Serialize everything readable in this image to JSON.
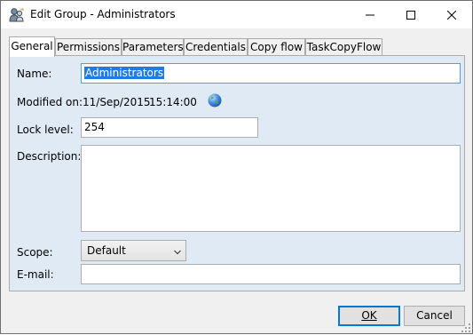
{
  "window": {
    "title": "Edit Group - Administrators",
    "icon": "group-user-icon",
    "controls": [
      "minimize-icon",
      "maximize-icon",
      "close-icon"
    ]
  },
  "tabs": [
    {
      "label": "General",
      "active": true
    },
    {
      "label": "Permissions",
      "active": false
    },
    {
      "label": "Parameters",
      "active": false
    },
    {
      "label": "Credentials",
      "active": false
    },
    {
      "label": "Copy flow",
      "active": false
    },
    {
      "label": "TaskCopyFlow",
      "active": false
    }
  ],
  "form": {
    "name_label": "Name:",
    "name_value": "Administrators",
    "modified_label": "Modified on:",
    "modified_date": "11/Sep/2015",
    "modified_time": "15:14:00",
    "lock_label": "Lock level:",
    "lock_value": "254",
    "description_label": "Description:",
    "description_value": "",
    "scope_label": "Scope:",
    "scope_value": "Default",
    "email_label": "E-mail:",
    "email_value": ""
  },
  "buttons": {
    "ok": "OK",
    "cancel": "Cancel"
  },
  "colors": {
    "panel_bg": "#dfeaf5",
    "selection": "#1e7ce6",
    "default_button_border": "#0078d7"
  }
}
